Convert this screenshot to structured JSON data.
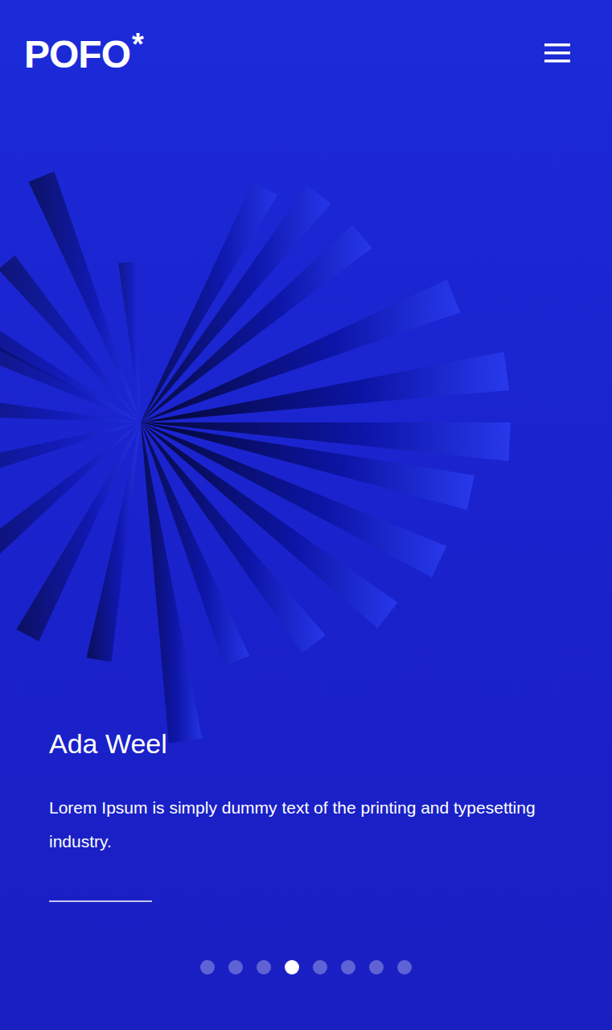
{
  "header": {
    "logo": {
      "text": "POFO",
      "mark": "*"
    }
  },
  "slide": {
    "title": "Ada Weel",
    "text": "Lorem Ipsum is simply dummy text of the printing and typesetting industry."
  },
  "pagination": [
    {
      "selected": false
    },
    {
      "selected": false
    },
    {
      "selected": false
    },
    {
      "selected": true
    },
    {
      "selected": false
    },
    {
      "selected": false
    },
    {
      "selected": false
    },
    {
      "selected": false
    }
  ]
}
